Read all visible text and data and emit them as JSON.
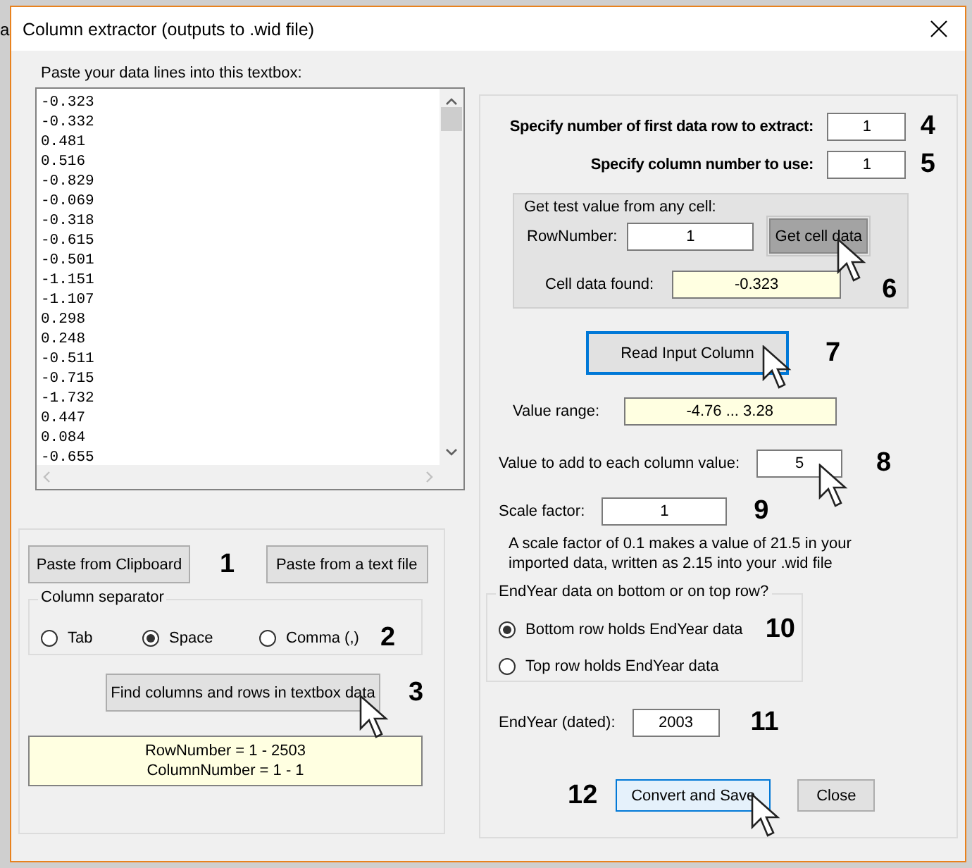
{
  "background_text": "a",
  "window": {
    "title": "Column extractor (outputs to .wid file)"
  },
  "data_box": {
    "label": "Paste your data lines into this textbox:",
    "lines": [
      "-0.323",
      "-0.332",
      "0.481",
      "0.516",
      "-0.829",
      "-0.069",
      "-0.318",
      "-0.615",
      "-0.501",
      "-1.151",
      "-1.107",
      "0.298",
      "0.248",
      "-0.511",
      "-0.715",
      "-1.732",
      "0.447",
      "0.084",
      "-0.655"
    ]
  },
  "paste": {
    "step": "1",
    "buttons": [
      "Paste from Clipboard",
      "Paste from a text file"
    ]
  },
  "separator": {
    "title": "Column separator",
    "step": "2",
    "options": [
      {
        "label": "Tab",
        "selected": false
      },
      {
        "label": "Space",
        "selected": true
      },
      {
        "label": "Comma (,)",
        "selected": false
      }
    ]
  },
  "find": {
    "button": "Find columns and rows in textbox data",
    "step": "3",
    "result": [
      "RowNumber = 1 - 2503",
      "ColumnNumber = 1 - 1"
    ]
  },
  "first_row": {
    "label": "Specify number of first data row to extract:",
    "value": "1",
    "step": "4"
  },
  "column": {
    "label": "Specify column number to use:",
    "value": "1",
    "step": "5"
  },
  "test": {
    "title": "Get test value from any cell:",
    "row_label": "RowNumber:",
    "row_value": "1",
    "button": "Get cell data",
    "found_label": "Cell data found:",
    "found_value": "-0.323",
    "step": "6"
  },
  "read": {
    "button": "Read Input Column",
    "step": "7",
    "range_label": "Value range:",
    "range_value": "-4.76 ... 3.28"
  },
  "add": {
    "label": "Value to add to each column value:",
    "value": "5",
    "step": "8"
  },
  "scale": {
    "label": "Scale factor:",
    "value": "1",
    "step": "9",
    "note": "A scale factor of 0.1 makes a value of 21.5 in your imported data, written as 2.15 into your .wid file"
  },
  "endyear_group": {
    "title": "EndYear data on bottom or on top row?",
    "step": "10",
    "options": [
      {
        "label": "Bottom row holds EndYear data",
        "selected": true
      },
      {
        "label": "Top row holds EndYear data",
        "selected": false
      }
    ]
  },
  "endyear": {
    "label": "EndYear (dated):",
    "value": "2003",
    "step": "11"
  },
  "actions": {
    "step": "12",
    "buttons": [
      "Convert and Save",
      "Close"
    ]
  }
}
